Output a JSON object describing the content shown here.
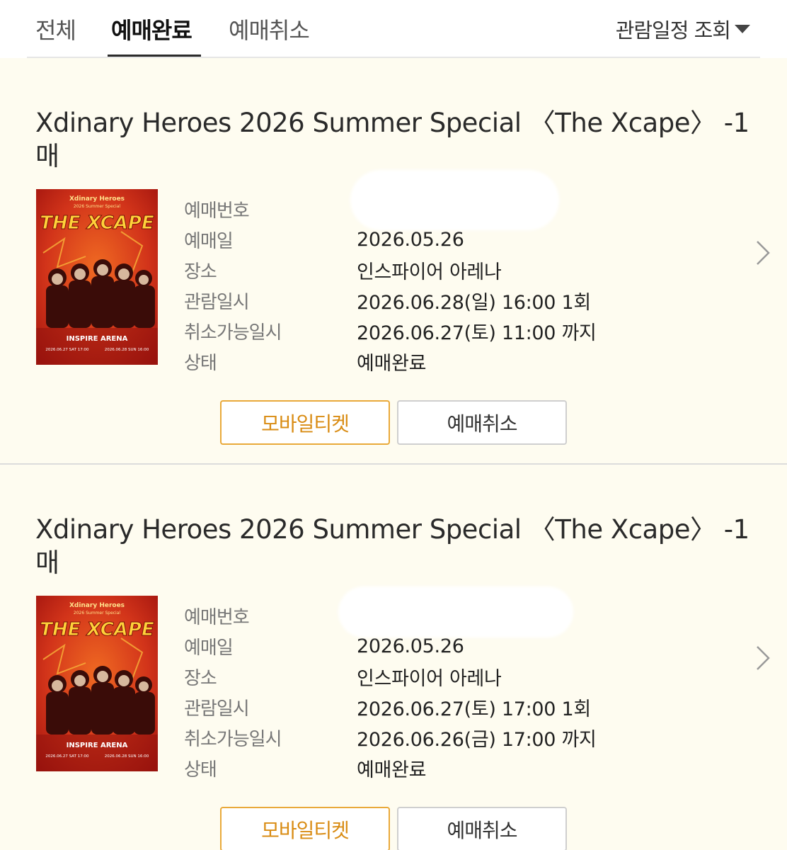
{
  "tabs": [
    {
      "label": "전체"
    },
    {
      "label": "예매완료"
    },
    {
      "label": "예매취소"
    }
  ],
  "active_tab": "예매완료",
  "schedule_filter": "관람일정 조회",
  "field_labels": {
    "booking_no": "예매번호",
    "booking_date": "예매일",
    "venue": "장소",
    "view_datetime": "관람일시",
    "cancel_deadline": "취소가능일시",
    "status": "상태"
  },
  "poster": {
    "band": "Xdinary Heroes",
    "subtitle": "2026 Summer Special",
    "title_art": "THE XCAPE",
    "venue": "INSPIRE ARENA",
    "date_left": "2026.06.27 SAT 17:00",
    "date_right": "2026.06.28 SUN 16:00"
  },
  "bookings": [
    {
      "title": "Xdinary Heroes 2026 Summer Special 〈The Xcape〉 -1매",
      "booking_no": "",
      "booking_date": "2026.05.26",
      "venue": "인스파이어 아레나",
      "view_datetime": "2026.06.28(일) 16:00 1회",
      "cancel_deadline": "2026.06.27(토) 11:00 까지",
      "status": "예매완료",
      "mobile_ticket_label": "모바일티켓",
      "cancel_label": "예매취소"
    },
    {
      "title": "Xdinary Heroes 2026 Summer Special 〈The Xcape〉 -1매",
      "booking_no": "",
      "booking_date": "2026.05.26",
      "venue": "인스파이어 아레나",
      "view_datetime": "2026.06.27(토) 17:00 1회",
      "cancel_deadline": "2026.06.26(금) 17:00 까지",
      "status": "예매완료",
      "mobile_ticket_label": "모바일티켓",
      "cancel_label": "예매취소"
    }
  ],
  "colors": {
    "page_bg": "#fefcf0",
    "accent": "#e9a93a",
    "poster_red": "#c8261a"
  }
}
